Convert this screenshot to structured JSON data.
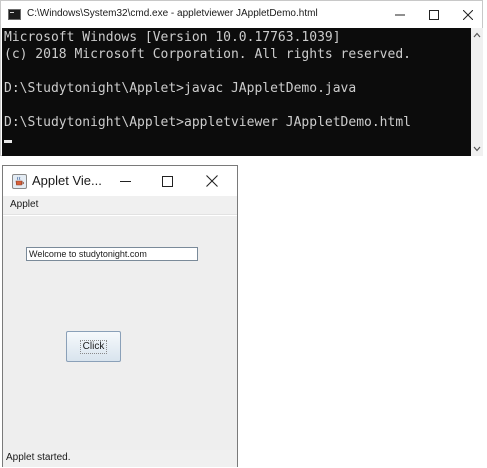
{
  "cmd_window": {
    "title": "C:\\Windows\\System32\\cmd.exe - appletviewer  JAppletDemo.html",
    "lines": [
      "Microsoft Windows [Version 10.0.17763.1039]",
      "(c) 2018 Microsoft Corporation. All rights reserved.",
      "",
      "D:\\Studytonight\\Applet>javac JAppletDemo.java",
      "",
      "D:\\Studytonight\\Applet>appletviewer JAppletDemo.html",
      ""
    ],
    "colors": {
      "console_bg": "#0c0c0c",
      "console_text": "#cccccc"
    }
  },
  "applet_window": {
    "title": "Applet Vie...",
    "menu": [
      "Applet"
    ],
    "text_field": {
      "value": "Welcome to studytonight.com"
    },
    "button": {
      "label": "Click"
    },
    "status": "Applet started.",
    "colors": {
      "content_bg": "#eeeeee",
      "button_border": "#8aa0b8"
    }
  },
  "icons": {
    "cmd": "console-icon",
    "applet": "java-cup-icon",
    "minimize": "minimize-icon",
    "maximize": "maximize-icon",
    "close": "close-icon",
    "scroll_up": "chevron-up-icon",
    "scroll_down": "chevron-down-icon"
  }
}
